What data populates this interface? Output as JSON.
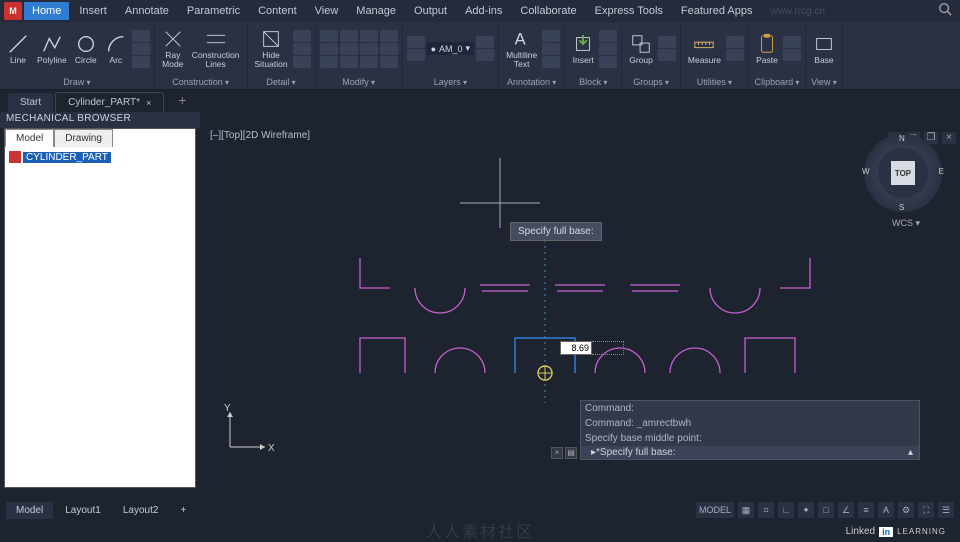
{
  "menubar": {
    "items": [
      "Home",
      "Insert",
      "Annotate",
      "Parametric",
      "Content",
      "View",
      "Manage",
      "Output",
      "Add-ins",
      "Collaborate",
      "Express Tools",
      "Featured Apps"
    ],
    "active_index": 0
  },
  "ribbon": {
    "panels": [
      {
        "title": "Draw",
        "tools": [
          {
            "name": "line",
            "label": "Line"
          },
          {
            "name": "polyline",
            "label": "Polyline"
          },
          {
            "name": "circle",
            "label": "Circle"
          },
          {
            "name": "arc",
            "label": "Arc"
          }
        ]
      },
      {
        "title": "Construction",
        "tools": [
          {
            "name": "ray",
            "label": "Ray\nMode"
          },
          {
            "name": "construction-lines",
            "label": "Construction\nLines"
          }
        ]
      },
      {
        "title": "Detail",
        "tools": [
          {
            "name": "hide-situation",
            "label": "Hide\nSituation"
          }
        ]
      },
      {
        "title": "Modify",
        "tools": []
      },
      {
        "title": "Layers",
        "tools": [],
        "layer_value": "AM_0"
      },
      {
        "title": "Annotation",
        "tools": [
          {
            "name": "multiline-text",
            "label": "Multiline\nText"
          }
        ]
      },
      {
        "title": "Block",
        "tools": [
          {
            "name": "insert",
            "label": "Insert"
          }
        ]
      },
      {
        "title": "Groups",
        "tools": [
          {
            "name": "group",
            "label": "Group"
          }
        ]
      },
      {
        "title": "Utilities",
        "tools": [
          {
            "name": "measure",
            "label": "Measure"
          }
        ]
      },
      {
        "title": "Clipboard",
        "tools": [
          {
            "name": "paste",
            "label": "Paste"
          }
        ]
      },
      {
        "title": "View",
        "tools": [
          {
            "name": "base",
            "label": "Base"
          }
        ]
      }
    ]
  },
  "file_tabs": {
    "items": [
      {
        "label": "Start",
        "active": false,
        "closeable": false
      },
      {
        "label": "Cylinder_PART*",
        "active": true,
        "closeable": true
      }
    ]
  },
  "browser": {
    "title": "MECHANICAL BROWSER",
    "tabs": [
      "Model",
      "Drawing"
    ],
    "active_tab": 0,
    "tree_root": "CYLINDER_PART"
  },
  "viewport": {
    "label": "[–][Top][2D Wireframe]",
    "tooltip": "Specify full base:",
    "dyn_input": "8.69",
    "viewcube": {
      "face": "TOP",
      "n": "N",
      "s": "S",
      "e": "E",
      "w": "W",
      "wcs": "WCS ▾"
    }
  },
  "command": {
    "history": [
      "Command:",
      "Command: _amrectbwh",
      "Specify base middle point:"
    ],
    "prompt": "▸*Specify full base:"
  },
  "status": {
    "tabs": [
      "Model",
      "Layout1",
      "Layout2"
    ],
    "active_tab": 0,
    "model_label": "MODEL"
  },
  "branding": {
    "linkedin": "Linked",
    "in": "in",
    "learn": "LEARNING"
  },
  "watermark_center": "www.rrcg.cn",
  "watermark_bottom": "人人素材社区"
}
